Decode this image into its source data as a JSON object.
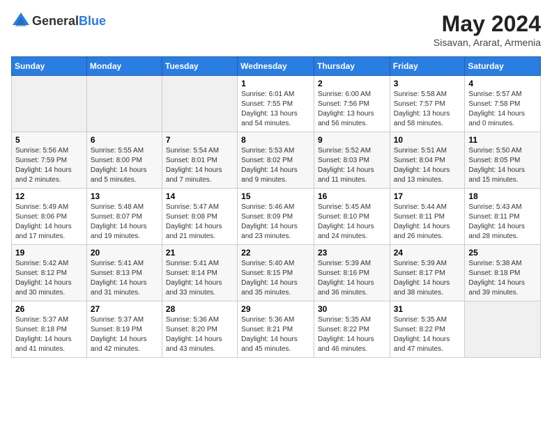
{
  "header": {
    "logo_general": "General",
    "logo_blue": "Blue",
    "title": "May 2024",
    "location": "Sisavan, Ararat, Armenia"
  },
  "weekdays": [
    "Sunday",
    "Monday",
    "Tuesday",
    "Wednesday",
    "Thursday",
    "Friday",
    "Saturday"
  ],
  "weeks": [
    [
      {
        "day": "",
        "sunrise": "",
        "sunset": "",
        "daylight": ""
      },
      {
        "day": "",
        "sunrise": "",
        "sunset": "",
        "daylight": ""
      },
      {
        "day": "",
        "sunrise": "",
        "sunset": "",
        "daylight": ""
      },
      {
        "day": "1",
        "sunrise": "Sunrise: 6:01 AM",
        "sunset": "Sunset: 7:55 PM",
        "daylight": "Daylight: 13 hours and 54 minutes."
      },
      {
        "day": "2",
        "sunrise": "Sunrise: 6:00 AM",
        "sunset": "Sunset: 7:56 PM",
        "daylight": "Daylight: 13 hours and 56 minutes."
      },
      {
        "day": "3",
        "sunrise": "Sunrise: 5:58 AM",
        "sunset": "Sunset: 7:57 PM",
        "daylight": "Daylight: 13 hours and 58 minutes."
      },
      {
        "day": "4",
        "sunrise": "Sunrise: 5:57 AM",
        "sunset": "Sunset: 7:58 PM",
        "daylight": "Daylight: 14 hours and 0 minutes."
      }
    ],
    [
      {
        "day": "5",
        "sunrise": "Sunrise: 5:56 AM",
        "sunset": "Sunset: 7:59 PM",
        "daylight": "Daylight: 14 hours and 2 minutes."
      },
      {
        "day": "6",
        "sunrise": "Sunrise: 5:55 AM",
        "sunset": "Sunset: 8:00 PM",
        "daylight": "Daylight: 14 hours and 5 minutes."
      },
      {
        "day": "7",
        "sunrise": "Sunrise: 5:54 AM",
        "sunset": "Sunset: 8:01 PM",
        "daylight": "Daylight: 14 hours and 7 minutes."
      },
      {
        "day": "8",
        "sunrise": "Sunrise: 5:53 AM",
        "sunset": "Sunset: 8:02 PM",
        "daylight": "Daylight: 14 hours and 9 minutes."
      },
      {
        "day": "9",
        "sunrise": "Sunrise: 5:52 AM",
        "sunset": "Sunset: 8:03 PM",
        "daylight": "Daylight: 14 hours and 11 minutes."
      },
      {
        "day": "10",
        "sunrise": "Sunrise: 5:51 AM",
        "sunset": "Sunset: 8:04 PM",
        "daylight": "Daylight: 14 hours and 13 minutes."
      },
      {
        "day": "11",
        "sunrise": "Sunrise: 5:50 AM",
        "sunset": "Sunset: 8:05 PM",
        "daylight": "Daylight: 14 hours and 15 minutes."
      }
    ],
    [
      {
        "day": "12",
        "sunrise": "Sunrise: 5:49 AM",
        "sunset": "Sunset: 8:06 PM",
        "daylight": "Daylight: 14 hours and 17 minutes."
      },
      {
        "day": "13",
        "sunrise": "Sunrise: 5:48 AM",
        "sunset": "Sunset: 8:07 PM",
        "daylight": "Daylight: 14 hours and 19 minutes."
      },
      {
        "day": "14",
        "sunrise": "Sunrise: 5:47 AM",
        "sunset": "Sunset: 8:08 PM",
        "daylight": "Daylight: 14 hours and 21 minutes."
      },
      {
        "day": "15",
        "sunrise": "Sunrise: 5:46 AM",
        "sunset": "Sunset: 8:09 PM",
        "daylight": "Daylight: 14 hours and 23 minutes."
      },
      {
        "day": "16",
        "sunrise": "Sunrise: 5:45 AM",
        "sunset": "Sunset: 8:10 PM",
        "daylight": "Daylight: 14 hours and 24 minutes."
      },
      {
        "day": "17",
        "sunrise": "Sunrise: 5:44 AM",
        "sunset": "Sunset: 8:11 PM",
        "daylight": "Daylight: 14 hours and 26 minutes."
      },
      {
        "day": "18",
        "sunrise": "Sunrise: 5:43 AM",
        "sunset": "Sunset: 8:11 PM",
        "daylight": "Daylight: 14 hours and 28 minutes."
      }
    ],
    [
      {
        "day": "19",
        "sunrise": "Sunrise: 5:42 AM",
        "sunset": "Sunset: 8:12 PM",
        "daylight": "Daylight: 14 hours and 30 minutes."
      },
      {
        "day": "20",
        "sunrise": "Sunrise: 5:41 AM",
        "sunset": "Sunset: 8:13 PM",
        "daylight": "Daylight: 14 hours and 31 minutes."
      },
      {
        "day": "21",
        "sunrise": "Sunrise: 5:41 AM",
        "sunset": "Sunset: 8:14 PM",
        "daylight": "Daylight: 14 hours and 33 minutes."
      },
      {
        "day": "22",
        "sunrise": "Sunrise: 5:40 AM",
        "sunset": "Sunset: 8:15 PM",
        "daylight": "Daylight: 14 hours and 35 minutes."
      },
      {
        "day": "23",
        "sunrise": "Sunrise: 5:39 AM",
        "sunset": "Sunset: 8:16 PM",
        "daylight": "Daylight: 14 hours and 36 minutes."
      },
      {
        "day": "24",
        "sunrise": "Sunrise: 5:39 AM",
        "sunset": "Sunset: 8:17 PM",
        "daylight": "Daylight: 14 hours and 38 minutes."
      },
      {
        "day": "25",
        "sunrise": "Sunrise: 5:38 AM",
        "sunset": "Sunset: 8:18 PM",
        "daylight": "Daylight: 14 hours and 39 minutes."
      }
    ],
    [
      {
        "day": "26",
        "sunrise": "Sunrise: 5:37 AM",
        "sunset": "Sunset: 8:18 PM",
        "daylight": "Daylight: 14 hours and 41 minutes."
      },
      {
        "day": "27",
        "sunrise": "Sunrise: 5:37 AM",
        "sunset": "Sunset: 8:19 PM",
        "daylight": "Daylight: 14 hours and 42 minutes."
      },
      {
        "day": "28",
        "sunrise": "Sunrise: 5:36 AM",
        "sunset": "Sunset: 8:20 PM",
        "daylight": "Daylight: 14 hours and 43 minutes."
      },
      {
        "day": "29",
        "sunrise": "Sunrise: 5:36 AM",
        "sunset": "Sunset: 8:21 PM",
        "daylight": "Daylight: 14 hours and 45 minutes."
      },
      {
        "day": "30",
        "sunrise": "Sunrise: 5:35 AM",
        "sunset": "Sunset: 8:22 PM",
        "daylight": "Daylight: 14 hours and 46 minutes."
      },
      {
        "day": "31",
        "sunrise": "Sunrise: 5:35 AM",
        "sunset": "Sunset: 8:22 PM",
        "daylight": "Daylight: 14 hours and 47 minutes."
      },
      {
        "day": "",
        "sunrise": "",
        "sunset": "",
        "daylight": ""
      }
    ]
  ]
}
